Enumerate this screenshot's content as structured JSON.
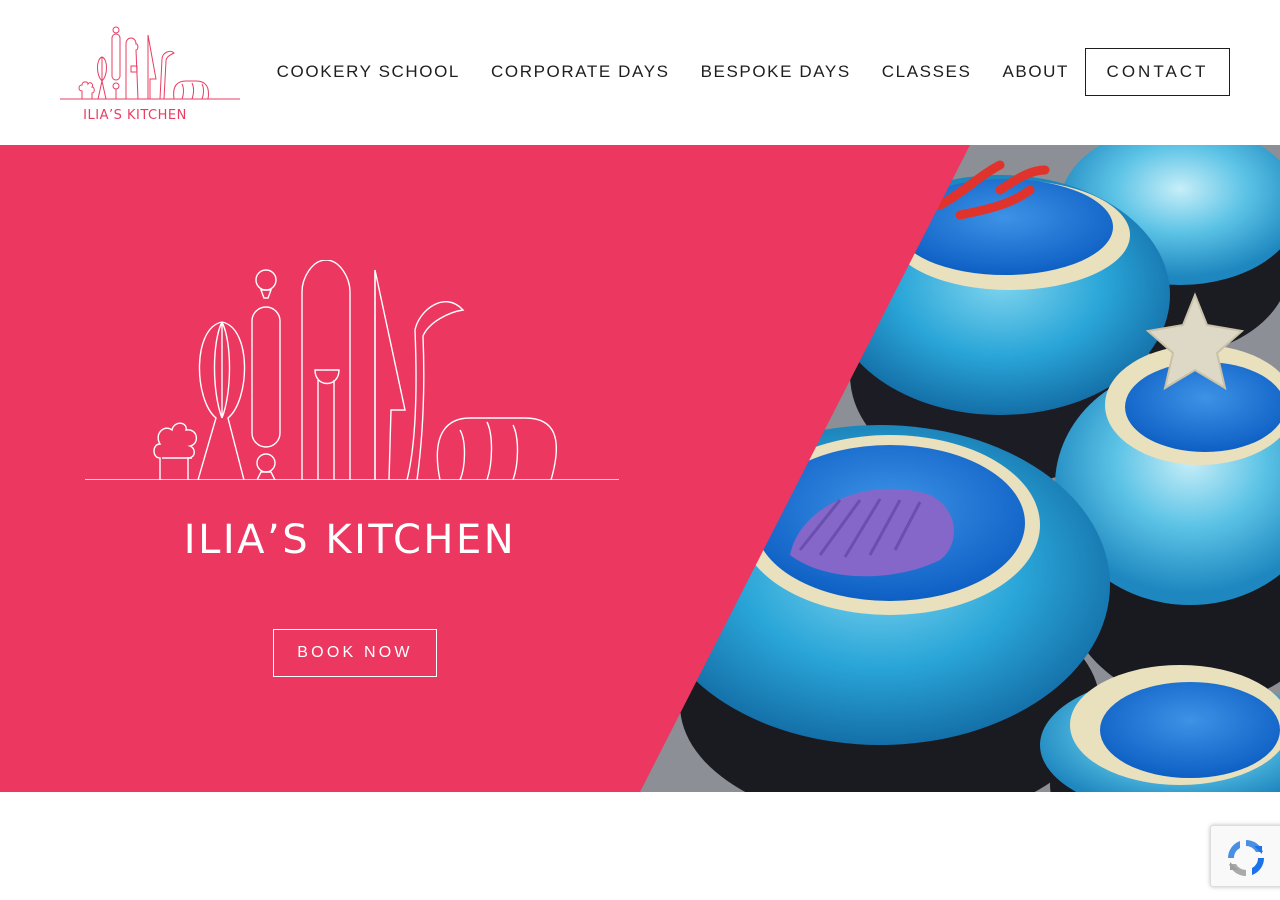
{
  "brand": {
    "logo_text": "ILIA’S KITCHEN",
    "accent_color": "#e83d62"
  },
  "nav": {
    "items": [
      {
        "label": "COOKERY SCHOOL"
      },
      {
        "label": "CORPORATE DAYS"
      },
      {
        "label": "BESPOKE DAYS"
      },
      {
        "label": "CLASSES"
      },
      {
        "label": "ABOUT"
      }
    ],
    "contact_label": "CONTACT"
  },
  "hero": {
    "title": "ILIA’S KITCHEN",
    "button_label": "BOOK NOW",
    "background_color": "#ec3760",
    "image_subject": "blue-frosted-cupcakes"
  },
  "widgets": {
    "recaptcha_icon": "recaptcha-icon"
  }
}
